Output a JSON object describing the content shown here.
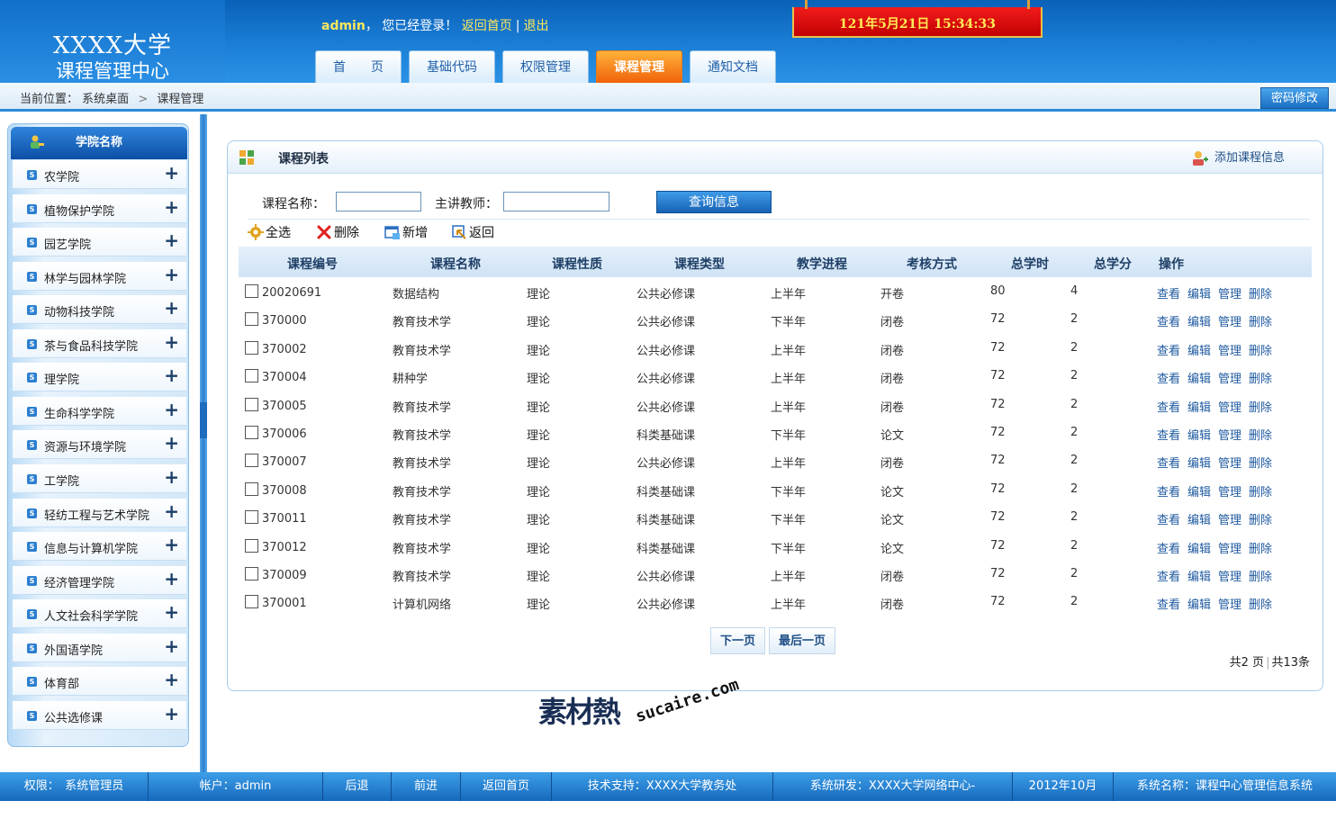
{
  "logo": {
    "line1": "XXXX大学",
    "line2": "课程管理中心"
  },
  "welcome": {
    "user": "admin",
    "comma": "，",
    "logged_in": "您已经登录！",
    "home": "返回首页",
    "sep": "|",
    "logout": "退出"
  },
  "clock": "121年5月21日  15:34:33",
  "nav": [
    {
      "label": "首　　页"
    },
    {
      "label": "基础代码"
    },
    {
      "label": "权限管理"
    },
    {
      "label": "课程管理"
    },
    {
      "label": "通知文档"
    }
  ],
  "breadcrumb": {
    "prefix": "当前位置：",
    "item1": "系统桌面",
    "arrow": ">",
    "item2": "课程管理"
  },
  "password_button": "密码修改",
  "sidebar": {
    "title": "学院名称",
    "items": [
      "农学院",
      "植物保护学院",
      "园艺学院",
      "林学与园林学院",
      "动物科技学院",
      "茶与食品科技学院",
      "理学院",
      "生命科学学院",
      "资源与环境学院",
      "工学院",
      "轻纺工程与艺术学院",
      "信息与计算机学院",
      "经济管理学院",
      "人文社会科学学院",
      "外国语学院",
      "体育部",
      "公共选修课"
    ],
    "item_badge": "S",
    "expand": "+"
  },
  "panel": {
    "title": "课程列表",
    "add": "添加课程信息"
  },
  "search": {
    "name_label": "课程名称：",
    "teacher_label": "主讲教师：",
    "name_value": "",
    "teacher_value": "",
    "button": "查询信息"
  },
  "toolbar": {
    "select_all": "全选",
    "delete": "删除",
    "add": "新增",
    "back": "返回"
  },
  "table": {
    "headers": [
      "课程编号",
      "课程名称",
      "课程性质",
      "课程类型",
      "教学进程",
      "考核方式",
      "总学时",
      "总学分",
      "操作"
    ],
    "actions": [
      "查看",
      "编辑",
      "管理",
      "删除"
    ],
    "rows": [
      [
        "20020691",
        "数据结构",
        "理论",
        "公共必修课",
        "上半年",
        "开卷",
        "80",
        "4"
      ],
      [
        "370000",
        "教育技术学",
        "理论",
        "公共必修课",
        "下半年",
        "闭卷",
        "72",
        "2"
      ],
      [
        "370002",
        "教育技术学",
        "理论",
        "公共必修课",
        "上半年",
        "闭卷",
        "72",
        "2"
      ],
      [
        "370004",
        "耕种学",
        "理论",
        "公共必修课",
        "上半年",
        "闭卷",
        "72",
        "2"
      ],
      [
        "370005",
        "教育技术学",
        "理论",
        "公共必修课",
        "上半年",
        "闭卷",
        "72",
        "2"
      ],
      [
        "370006",
        "教育技术学",
        "理论",
        "科类基础课",
        "下半年",
        "论文",
        "72",
        "2"
      ],
      [
        "370007",
        "教育技术学",
        "理论",
        "公共必修课",
        "上半年",
        "闭卷",
        "72",
        "2"
      ],
      [
        "370008",
        "教育技术学",
        "理论",
        "科类基础课",
        "下半年",
        "论文",
        "72",
        "2"
      ],
      [
        "370011",
        "教育技术学",
        "理论",
        "科类基础课",
        "下半年",
        "论文",
        "72",
        "2"
      ],
      [
        "370012",
        "教育技术学",
        "理论",
        "科类基础课",
        "下半年",
        "论文",
        "72",
        "2"
      ],
      [
        "370009",
        "教育技术学",
        "理论",
        "公共必修课",
        "上半年",
        "闭卷",
        "72",
        "2"
      ],
      [
        "370001",
        "计算机网络",
        "理论",
        "公共必修课",
        "上半年",
        "闭卷",
        "72",
        "2"
      ]
    ]
  },
  "pager": {
    "next": "下一页",
    "last": "最后一页",
    "pages": "共2 页",
    "sep": "|",
    "total": "共13条"
  },
  "watermark": {
    "cn": "素材熱",
    "en": "sucaire.com"
  },
  "footer": {
    "role": "权限：　系统管理员",
    "account": "帐户：admin",
    "back": "后退",
    "forward": "前进",
    "home": "返回首页",
    "support": "技术支持：XXXX大学教务处",
    "developer": "系统研发：XXXX大学网络中心-",
    "date": "2012年10月",
    "system": "系统名称：课程中心管理信息系统"
  },
  "colors": {
    "header_blue": "#1b7fd6",
    "active_tab": "#f0620a",
    "clock_red": "#d80000",
    "clock_text": "#ffeb55",
    "link_yellow": "#ffe85a",
    "action_link": "#1f5aa0"
  }
}
